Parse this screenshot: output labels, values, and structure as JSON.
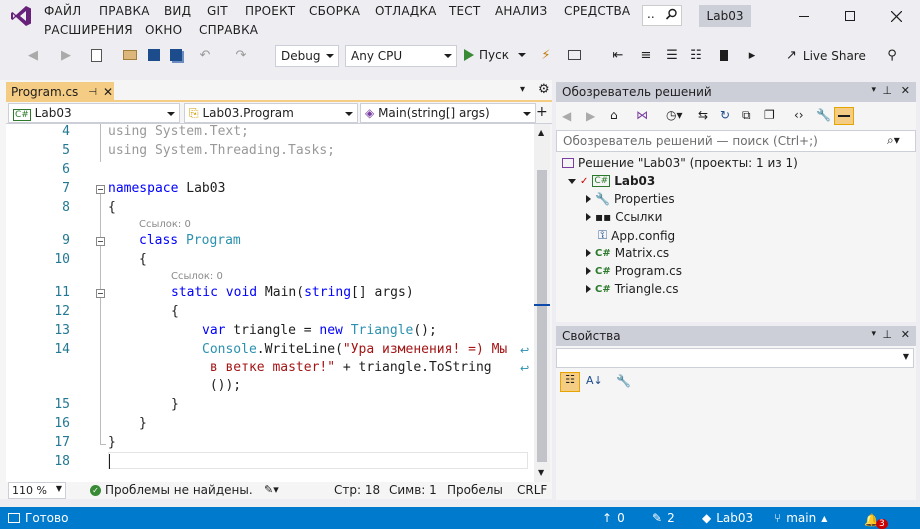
{
  "menu": {
    "items": [
      "ФАЙЛ",
      "ПРАВКА",
      "ВИД",
      "GIT",
      "ПРОЕКТ",
      "СБОРКА",
      "ОТЛАДКА",
      "ТЕСТ",
      "АНАЛИЗ",
      "СРЕДСТВА",
      "РАСШИРЕНИЯ",
      "ОКНО",
      "СПРАВКА"
    ],
    "solution_name": "Lab03"
  },
  "toolbar": {
    "config": "Debug",
    "platform": "Any CPU",
    "run_label": "Пуск",
    "live_share": "Live Share"
  },
  "editor": {
    "tab_label": "Program.cs",
    "nav_project": "Lab03",
    "nav_class": "Lab03.Program",
    "nav_member": "Main(string[] args)",
    "zoom": "110 %",
    "problems": "Проблемы не найдены.",
    "line_pos": "Стр: 18",
    "col_pos": "Симв: 1",
    "whitespace": "Пробелы",
    "eol": "CRLF",
    "ref_hint_1": "Ссылок: 0",
    "ref_hint_2": "Ссылок: 0",
    "line_numbers": [
      "4",
      "5",
      "6",
      "7",
      "8",
      "9",
      "10",
      "11",
      "12",
      "13",
      "14",
      "15",
      "16",
      "17",
      "18"
    ]
  },
  "solution_explorer": {
    "title": "Обозреватель решений",
    "search_placeholder": "Обозреватель решений — поиск (Ctrl+;)",
    "solution_label": "Решение \"Lab03\" (проекты: 1 из 1)",
    "project_label": "Lab03",
    "items": [
      "Properties",
      "Ссылки",
      "App.config",
      "Matrix.cs",
      "Program.cs",
      "Triangle.cs"
    ]
  },
  "properties": {
    "title": "Свойства"
  },
  "status": {
    "ready": "Готово",
    "up_count": "0",
    "pencil_count": "2",
    "repo": "Lab03",
    "branch": "main",
    "notifications": "3"
  },
  "colors": {
    "accent": "#007acc",
    "tab_active": "#f5cc84",
    "keyword": "#0000ff",
    "type": "#2b91af",
    "string": "#a31515"
  }
}
